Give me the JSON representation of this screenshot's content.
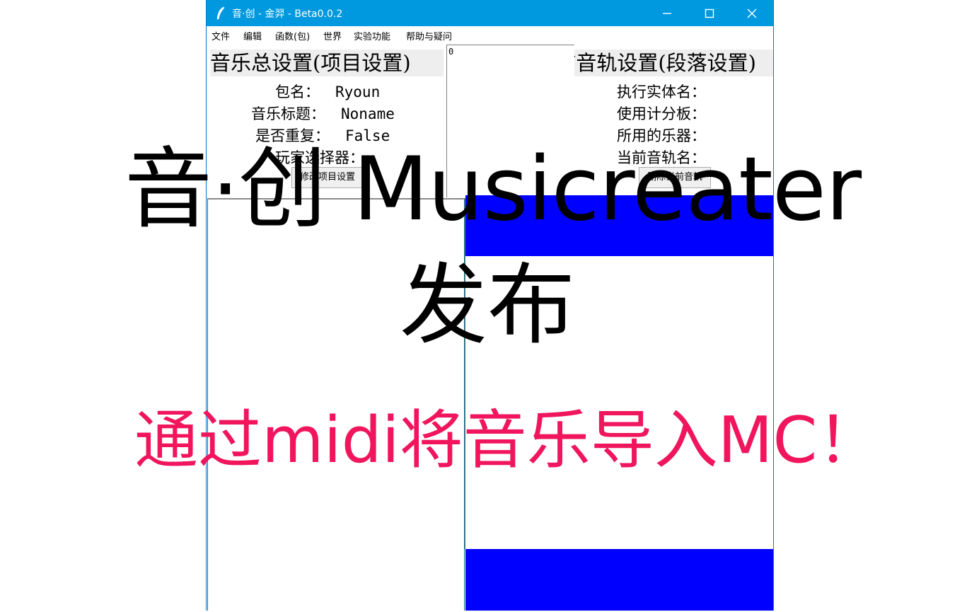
{
  "window": {
    "title": "音·创 - 金羿 - Beta0.0.2",
    "icon": "feather-pen-icon"
  },
  "menu": [
    "文件",
    "编辑",
    "函数(包)",
    "世界",
    "实验功能",
    "帮助与疑问"
  ],
  "project_panel": {
    "title": "音乐总设置(项目设置)",
    "fields": [
      {
        "label": "包名：",
        "value": "Ryoun"
      },
      {
        "label": "音乐标题：",
        "value": "Noname"
      },
      {
        "label": "是否重复：",
        "value": "False"
      },
      {
        "label": "玩家选择器：",
        "value": ""
      }
    ],
    "button": "修改项目设置"
  },
  "middle_panel": {
    "value": "0"
  },
  "track_panel": {
    "title": "当前音轨设置(段落设置)",
    "fields": [
      {
        "label": "执行实体名："
      },
      {
        "label": "使用计分板："
      },
      {
        "label": "所用的乐器："
      },
      {
        "label": "当前音轨名："
      }
    ],
    "button": "删除当前音轨"
  },
  "overlay": {
    "title": "音·创 Musicreater",
    "subtitle": "发布",
    "tagline": "通过midi将音乐导入MC！"
  },
  "colors": {
    "titlebar": "#0099e0",
    "blue_bar": "#0000ff",
    "tagline": "#f0155d"
  }
}
